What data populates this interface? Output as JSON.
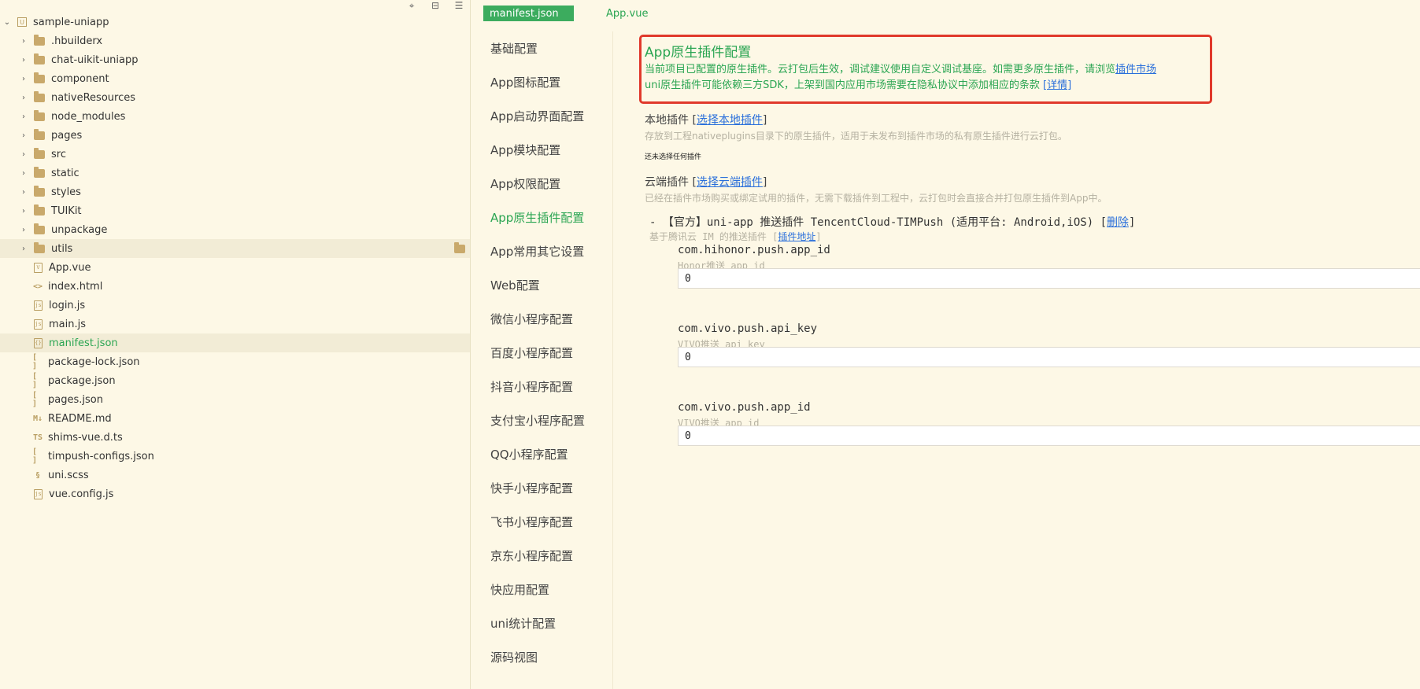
{
  "explorer": {
    "project_name": "sample-uniapp",
    "tree": [
      {
        "label": "sample-uniapp",
        "type": "project",
        "expanded": true
      },
      {
        "label": ".hbuilderx",
        "type": "folder"
      },
      {
        "label": "chat-uikit-uniapp",
        "type": "folder"
      },
      {
        "label": "component",
        "type": "folder"
      },
      {
        "label": "nativeResources",
        "type": "folder"
      },
      {
        "label": "node_modules",
        "type": "folder"
      },
      {
        "label": "pages",
        "type": "folder"
      },
      {
        "label": "src",
        "type": "folder"
      },
      {
        "label": "static",
        "type": "folder"
      },
      {
        "label": "styles",
        "type": "folder"
      },
      {
        "label": "TUIKit",
        "type": "folder"
      },
      {
        "label": "unpackage",
        "type": "folder"
      },
      {
        "label": "utils",
        "type": "folder"
      },
      {
        "label": "App.vue",
        "type": "file",
        "icon": "V"
      },
      {
        "label": "index.html",
        "type": "file",
        "icon": "<>"
      },
      {
        "label": "login.js",
        "type": "file",
        "icon": "js"
      },
      {
        "label": "main.js",
        "type": "file",
        "icon": "js"
      },
      {
        "label": "manifest.json",
        "type": "file",
        "icon": "{}"
      },
      {
        "label": "package-lock.json",
        "type": "file",
        "icon": "[]"
      },
      {
        "label": "package.json",
        "type": "file",
        "icon": "[]"
      },
      {
        "label": "pages.json",
        "type": "file",
        "icon": "[]"
      },
      {
        "label": "README.md",
        "type": "file",
        "icon": "M↓"
      },
      {
        "label": "shims-vue.d.ts",
        "type": "file",
        "icon": "TS"
      },
      {
        "label": "timpush-configs.json",
        "type": "file",
        "icon": "[]"
      },
      {
        "label": "uni.scss",
        "type": "file",
        "icon": "§"
      },
      {
        "label": "vue.config.js",
        "type": "file",
        "icon": "js"
      }
    ]
  },
  "tabs": {
    "active": "manifest.json",
    "other": "App.vue"
  },
  "settings_nav": [
    "基础配置",
    "App图标配置",
    "App启动界面配置",
    "App模块配置",
    "App权限配置",
    "App原生插件配置",
    "App常用其它设置",
    "Web配置",
    "微信小程序配置",
    "百度小程序配置",
    "抖音小程序配置",
    "支付宝小程序配置",
    "QQ小程序配置",
    "快手小程序配置",
    "飞书小程序配置",
    "京东小程序配置",
    "快应用配置",
    "uni统计配置",
    "源码视图"
  ],
  "content": {
    "title": "App原生插件配置",
    "desc_line1": "当前项目已配置的原生插件。云打包后生效，调试建议使用自定义调试基座。如需更多原生插件，请浏览",
    "desc_link1": "插件市场",
    "desc_line2": "uni原生插件可能依赖三方SDK，上架到国内应用市场需要在隐私协议中添加相应的条款",
    "desc_link2": "[详情]",
    "local_label": "本地插件",
    "local_bracket_open": "[",
    "local_link": "选择本地插件",
    "local_bracket_close": "]",
    "local_hint": "存放到工程nativeplugins目录下的原生插件，适用于未发布到插件市场的私有原生插件进行云打包。",
    "local_none": "还未选择任何插件",
    "cloud_label": "云端插件",
    "cloud_bracket_open": "[",
    "cloud_link": "选择云端插件",
    "cloud_bracket_close": "]",
    "cloud_hint": "已经在插件市场购买或绑定试用的插件，无需下载插件到工程中，云打包时会直接合并打包原生插件到App中。",
    "plugin": {
      "line": "- 【官方】uni-app 推送插件 TencentCloud-TIMPush (适用平台: Android,iOS) [",
      "delete_link": "删除",
      "line_end": "]",
      "sub": "基于腾讯云 IM 的推送插件 [",
      "sub_link": "插件地址",
      "sub_end": "]"
    },
    "params": [
      {
        "name": "com.hihonor.push.app_id",
        "hint": "Honor推送 app_id",
        "value": "0"
      },
      {
        "name": "com.vivo.push.api_key",
        "hint": "VIVO推送 api_key",
        "value": "0"
      },
      {
        "name": "com.vivo.push.app_id",
        "hint": "VIVO推送 app_id",
        "value": "0"
      }
    ]
  },
  "colors": {
    "background": "#fdf8e6",
    "accent_green": "#2aa552",
    "tab_green": "#3cac5e",
    "highlight_red": "#e0392b",
    "link_blue": "#2a6fdb"
  }
}
